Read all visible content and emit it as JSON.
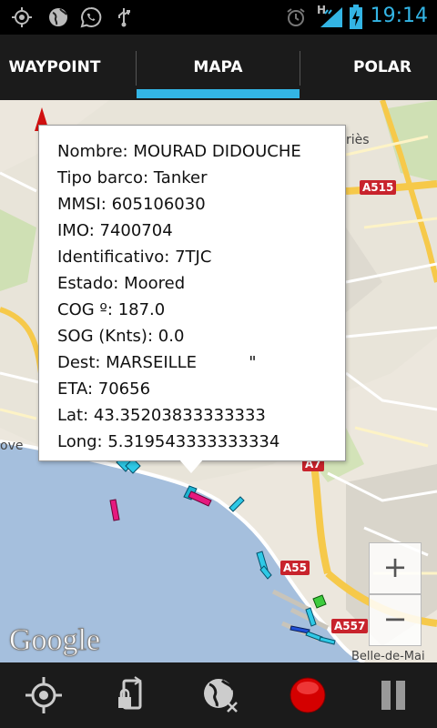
{
  "status_bar": {
    "time": "19:14",
    "network_type": "H",
    "left_icons": [
      "gps-icon",
      "globe-icon",
      "whatsapp-icon",
      "usb-icon"
    ],
    "right_icons": [
      "alarm-icon",
      "signal-icon",
      "battery-charging-icon"
    ]
  },
  "tabs": [
    {
      "label": "WAYPOINT",
      "selected": false
    },
    {
      "label": "MAPA",
      "selected": true
    },
    {
      "label": "POLAR",
      "selected": false
    }
  ],
  "accent_color": "#33b5e5",
  "popup": {
    "rows": [
      {
        "label": "Nombre:",
        "value": "MOURAD DIDOUCHE"
      },
      {
        "label": "Tipo barco:",
        "value": "Tanker"
      },
      {
        "label": "MMSI:",
        "value": "605106030"
      },
      {
        "label": "IMO:",
        "value": "7400704"
      },
      {
        "label": "Identificativo:",
        "value": "7TJC"
      },
      {
        "label": "Estado:",
        "value": "Moored"
      },
      {
        "label": "COG º:",
        "value": "187.0"
      },
      {
        "label": "SOG (Knts):",
        "value": "0.0"
      },
      {
        "label": "Dest:",
        "value": "MARSEILLE          \""
      },
      {
        "label": "ETA:",
        "value": "70656"
      },
      {
        "label": "Lat:",
        "value": "43.35203833333333"
      },
      {
        "label": "Long:",
        "value": "5.319543333333334"
      }
    ]
  },
  "map": {
    "road_labels": [
      "A515",
      "A7",
      "A55",
      "A557"
    ],
    "place_labels": [
      "riès",
      "ove",
      "Belle-de-Mai"
    ],
    "attribution": "Google",
    "zoom_in": "+",
    "zoom_out": "−"
  },
  "bottom_bar": {
    "icons": [
      "locate-icon",
      "lock-rotation-icon",
      "globe-off-icon",
      "record-icon",
      "pause-icon"
    ]
  }
}
